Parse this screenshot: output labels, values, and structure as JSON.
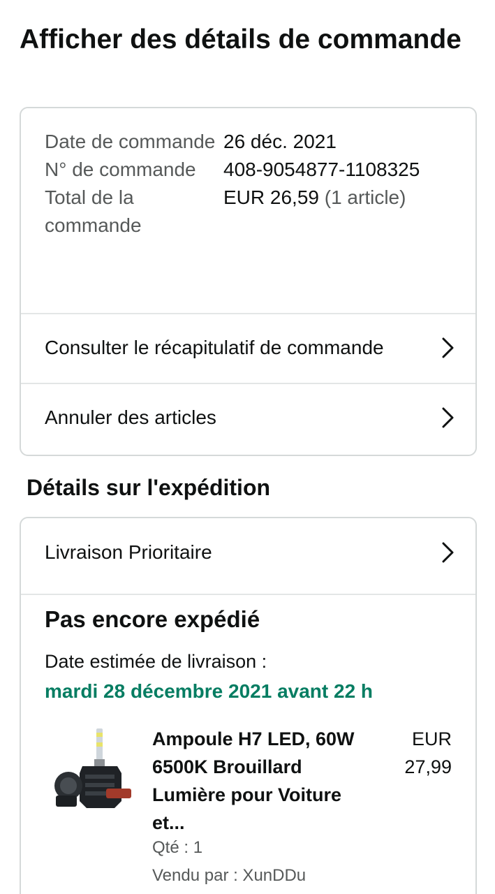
{
  "page": {
    "title": "Afficher des détails de commande"
  },
  "order": {
    "date_label": "Date de commande",
    "date_value": "26 déc. 2021",
    "number_label": "N° de commande",
    "number_value": "408-9054877-1108325",
    "total_label": "Total de la commande",
    "total_value": "EUR 26,59",
    "total_items": "(1 article)"
  },
  "actions": {
    "summary_label": "Consulter le récapitulatif de commande",
    "cancel_label": "Annuler des articles"
  },
  "shipping": {
    "section_title": "Détails sur l'expédition",
    "method_label": "Livraison Prioritaire",
    "status": "Pas encore expédié",
    "estimate_label": "Date estimée de livraison :",
    "estimate_date": "mardi 28 décembre 2021 avant 22 h",
    "date_color": "#067d62"
  },
  "product": {
    "image_icon": "headlight-bulb-image",
    "title": "Ampoule H7 LED, 60W 6500K Brouillard Lumière pour Voiture et...",
    "price_currency": "EUR",
    "price_value": "27,99",
    "quantity": "Qté : 1",
    "seller": "Vendu par : XunDDu"
  }
}
